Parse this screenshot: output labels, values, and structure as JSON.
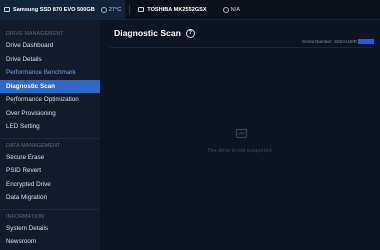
{
  "topbar": {
    "drives": [
      {
        "name": "Samsung SSD 870 EVO 500GB",
        "temp": "27°C"
      },
      {
        "name": "TOSHIBA MK2552GSX",
        "temp": "N/A"
      }
    ]
  },
  "sidebar": {
    "sections": [
      {
        "title": "DRIVE MANAGEMENT",
        "items": [
          "Drive Dashboard",
          "Drive Details",
          "Performance Benchmark",
          "Diagnostic Scan",
          "Performance Optimization",
          "Over Provisioning",
          "LED Setting"
        ]
      },
      {
        "title": "DATA MANAGEMENT",
        "items": [
          "Secure Erase",
          "PSID Revert",
          "Encrypted Drive",
          "Data Migration"
        ]
      },
      {
        "title": "INFORMATION",
        "items": [
          "System Details",
          "Newsroom"
        ]
      }
    ]
  },
  "main": {
    "title": "Diagnostic Scan",
    "help_symbol": "?",
    "serial_label": "Serial Number: S6ZAHJ0R",
    "empty_message": "The drive is not supported."
  },
  "colors": {
    "accent": "#2d6ac8",
    "link": "#6fa0e8",
    "background": "#0d1521"
  },
  "icons": {
    "drive": "drive-icon",
    "temperature": "temperature-icon",
    "help": "help-icon",
    "empty_state": "unsupported-drive-icon"
  }
}
